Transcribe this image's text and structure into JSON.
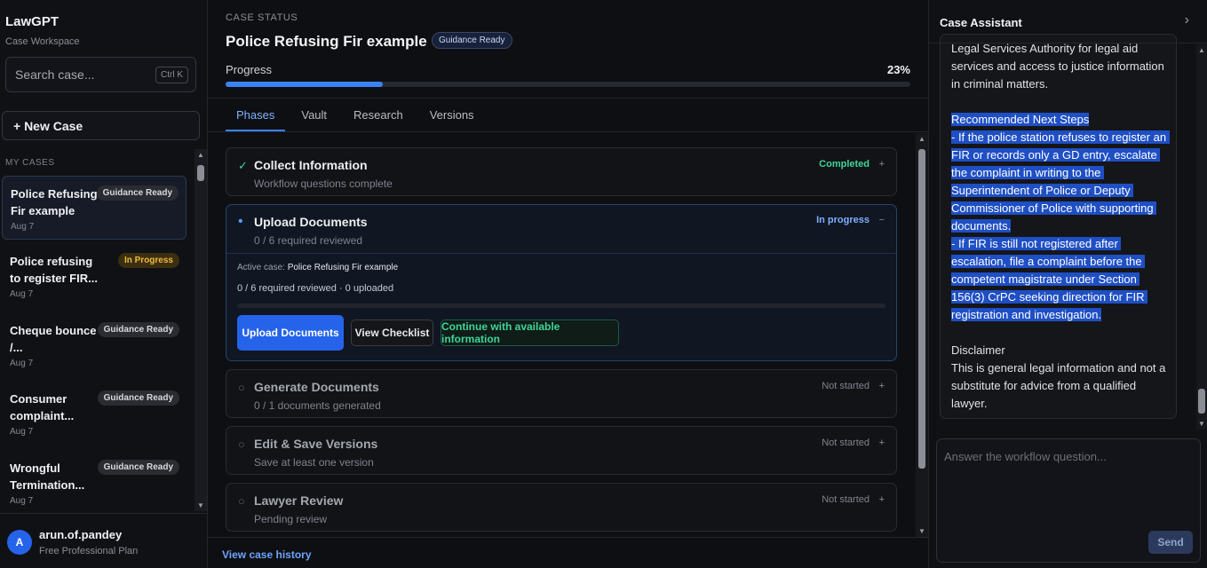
{
  "sidebar": {
    "brand": "LawGPT",
    "brand_sub": "Case Workspace",
    "search_placeholder": "Search case...",
    "search_shortcut": "Ctrl K",
    "new_case_label": "+ New Case",
    "section_label": "MY CASES",
    "cases": [
      {
        "title": "Police Refusing Fir example",
        "badge": "Guidance Ready",
        "date": "Aug 7"
      },
      {
        "title": "Police refusing to register FIR...",
        "badge": "In Progress",
        "date": "Aug 7"
      },
      {
        "title": "Cheque bounce /...",
        "badge": "Guidance Ready",
        "date": "Aug 7"
      },
      {
        "title": "Consumer complaint...",
        "badge": "Guidance Ready",
        "date": "Aug 7"
      },
      {
        "title": "Wrongful Termination...",
        "badge": "Guidance Ready",
        "date": "Aug 7"
      }
    ],
    "user": {
      "initial": "A",
      "name": "arun.of.pandey",
      "plan": "Free Professional Plan"
    }
  },
  "main": {
    "status_label": "CASE STATUS",
    "case_title": "Police Refusing Fir example",
    "case_badge": "Guidance Ready",
    "progress_label": "Progress",
    "progress_text": "23%",
    "progress_value": 0.23,
    "tabs": [
      "Phases",
      "Vault",
      "Research",
      "Versions"
    ],
    "active_tab": "Phases",
    "phases": [
      {
        "icon": "check-icon",
        "title": "Collect Information",
        "subtitle": "Workflow questions complete",
        "status": "Completed",
        "toggle": "+"
      },
      {
        "icon": "dot-icon",
        "title": "Upload Documents",
        "subtitle": "0 / 6 required reviewed",
        "status": "In progress",
        "toggle": "−",
        "active_case_label": "Active case:",
        "active_case_name": "Police Refusing Fir example",
        "counts": "0 / 6 required reviewed · 0 uploaded",
        "upload_button": "Upload Documents",
        "checklist_button": "View Checklist",
        "continue_button": "Continue with available information"
      },
      {
        "icon": "circle-icon",
        "title": "Generate Documents",
        "subtitle": "0 / 1 documents generated",
        "status": "Not started",
        "toggle": "+"
      },
      {
        "icon": "circle-icon",
        "title": "Edit & Save Versions",
        "subtitle": "Save at least one version",
        "status": "Not started",
        "toggle": "+"
      },
      {
        "icon": "circle-icon",
        "title": "Lawyer Review",
        "subtitle": "Pending review",
        "status": "Not started",
        "toggle": "+"
      }
    ],
    "history_link": "View case history",
    "colors": {
      "accent": "#3b82f6",
      "completed": "#3ed598",
      "in_progress": "#7fb0ff",
      "not_started": "#7f838c"
    }
  },
  "assistant": {
    "title": "Case Assistant",
    "message_intro": "Legal Services Authority for legal aid services and access to justice information in criminal matters.",
    "message_selected": "Recommended Next Steps\n- If the police station refuses to register an FIR or records only a GD entry, escalate the complaint in writing to the Superintendent of Police or Deputy Commissioner of Police with supporting documents.\n- If FIR is still not registered after escalation, file a complaint before the competent magistrate under Section 156(3) CrPC seeking direction for FIR registration and investigation.",
    "message_outro": "Disclaimer\nThis is general legal information and not a substitute for advice from a qualified lawyer.",
    "answer_placeholder": "Answer the workflow question...",
    "send_label": "Send"
  }
}
